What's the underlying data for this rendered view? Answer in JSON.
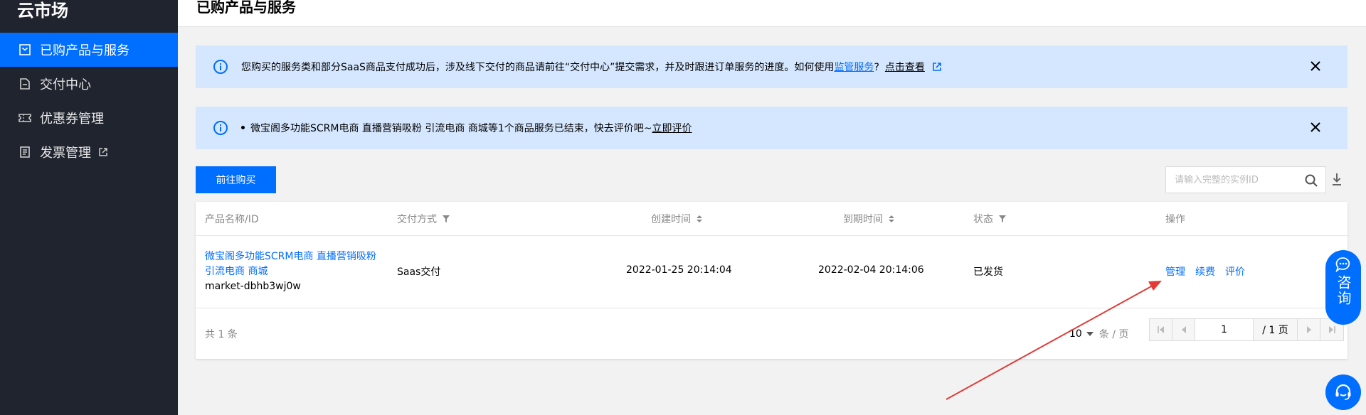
{
  "sidebar": {
    "brand": "云市场",
    "items": [
      {
        "label": "已购产品与服务",
        "icon": "purchased-icon",
        "active": true
      },
      {
        "label": "交付中心",
        "icon": "delivery-icon",
        "active": false
      },
      {
        "label": "优惠券管理",
        "icon": "coupon-icon",
        "active": false
      },
      {
        "label": "发票管理",
        "icon": "invoice-icon",
        "active": false,
        "external": true
      }
    ]
  },
  "header": {
    "title": "已购产品与服务"
  },
  "notices": [
    {
      "text": "您购买的服务类和部分SaaS商品支付成功后，涉及线下交付的商品请前往“交付中心”提交需求，并及时跟进订单服务的进度。如何使用",
      "link1": "监管服务",
      "mid": "?",
      "link2": "点击查看"
    },
    {
      "text": "微宝阁多功能SCRM电商 直播营销吸粉 引流电商 商城等1个商品服务已结束，快去评价吧~",
      "link": "立即评价"
    }
  ],
  "toolbar": {
    "buy_label": "前往购买",
    "search_placeholder": "请输入完整的实例ID"
  },
  "table": {
    "columns": [
      "产品名称/ID",
      "交付方式",
      "创建时间",
      "到期时间",
      "状态",
      "操作"
    ],
    "rows": [
      {
        "name": "微宝阁多功能SCRM电商 直播营销吸粉 引流电商 商城",
        "id": "market-dbhb3wj0w",
        "delivery": "Saas交付",
        "created": "2022-01-25 20:14:04",
        "expires": "2022-02-04 20:14:06",
        "status": "已发货",
        "actions": [
          "管理",
          "续费",
          "评价"
        ]
      }
    ]
  },
  "pagination": {
    "total_text": "共 1 条",
    "page_size": "10",
    "page_size_unit": "条 / 页",
    "current_page": "1",
    "page_count": "/ 1 页"
  },
  "consult": {
    "label": "咨询"
  },
  "colors": {
    "primary": "#006eff",
    "sidebar": "#1f242e",
    "notice_bg": "#d5e7ff",
    "annotation_arrow": "#e53935"
  }
}
